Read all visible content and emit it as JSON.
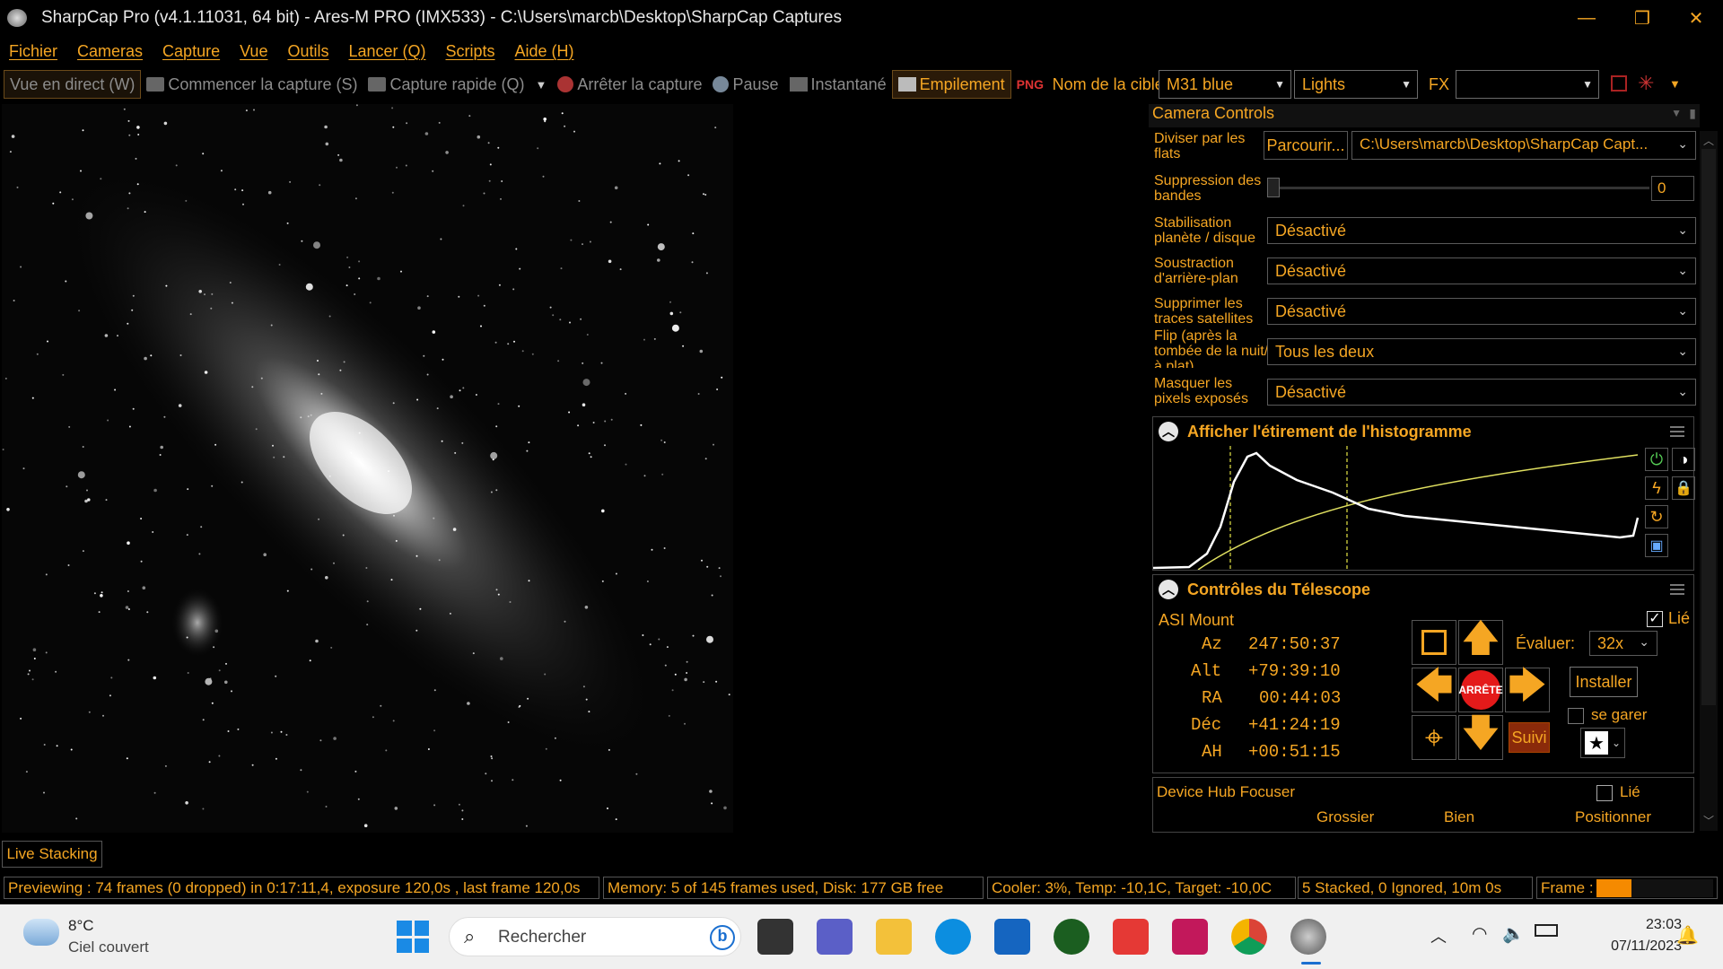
{
  "titlebar": {
    "title": "SharpCap Pro (v4.1.11031, 64 bit) - Ares-M PRO (IMX533) - C:\\Users\\marcb\\Desktop\\SharpCap Captures",
    "minimize": "—",
    "restore": "❐",
    "close": "✕"
  },
  "menu": [
    "Fichier",
    "Cameras",
    "Capture",
    "Vue",
    "Outils",
    "Lancer (Q)",
    "Scripts",
    "Aide (H)"
  ],
  "toolbar": {
    "live_view": "Vue en direct (W)",
    "start_capture": "Commencer la capture (S)",
    "quick_capture": "Capture rapide (Q)",
    "stop_capture": "Arrêter la capture",
    "pause": "Pause",
    "snapshot": "Instantané",
    "stacking": "Empilement",
    "target_label": "Nom de la cible:",
    "target_value": "M31 blue",
    "frame_type": "Lights",
    "fx_label": "FX",
    "fx_value": ""
  },
  "camera_controls": {
    "title": "Camera Controls",
    "flats_label": "Diviser par les flats",
    "browse": "Parcourir...",
    "flats_path": "C:\\Users\\marcb\\Desktop\\SharpCap Capt...",
    "banding_label": "Suppression des bandes",
    "banding_value": "0",
    "stabilization_label": "Stabilisation planète / disque",
    "stabilization_value": "Désactivé",
    "background_label": "Soustraction d'arrière-plan",
    "background_value": "Désactivé",
    "satellite_label": "Supprimer les traces satellites",
    "satellite_value": "Désactivé",
    "flip_label": "Flip (après la tombée de la nuit/à plat)",
    "flip_value": "Tous les deux",
    "mask_label": "Masquer les pixels exposés",
    "mask_value": "Désactivé"
  },
  "histogram": {
    "title": "Afficher l'étirement de l'histogramme"
  },
  "telescope": {
    "title": "Contrôles du Télescope",
    "mount": "ASI Mount",
    "linked": "Lié",
    "az_label": "Az",
    "az": "247:50:37",
    "alt_label": "Alt",
    "alt": "+79:39:10",
    "ra_label": "RA",
    "ra": "00:44:03",
    "dec_label": "Déc",
    "dec": "+41:24:19",
    "ah_label": "AH",
    "ah": "+00:51:15",
    "rate_label": "Évaluer:",
    "rate": "32x",
    "install": "Installer",
    "park": "se garer",
    "stop": "ARRÊTE",
    "track": "Suivi"
  },
  "focuser": {
    "title": "Device Hub Focuser",
    "linked": "Lié",
    "coarse": "Grossier",
    "fine": "Bien",
    "positioner": "Positionner"
  },
  "live_stacking": "Live Stacking",
  "status": {
    "preview": "Previewing : 74 frames (0 dropped) in 0:17:11,4, exposure 120,0s , last frame 120,0s",
    "memory": "Memory: 5 of 145 frames used, Disk: 177 GB free",
    "cooler": "Cooler: 3%, Temp: -10,1C, Target: -10,0C",
    "stacked": "5 Stacked, 0 Ignored, 10m 0s",
    "frame_label": "Frame :",
    "frame_progress": 0.3
  },
  "taskbar": {
    "temp": "8°C",
    "weather": "Ciel couvert",
    "search": "Rechercher",
    "time": "23:03",
    "date": "07/11/2023"
  },
  "colors": {
    "accent": "#f5a623",
    "background": "#000000"
  }
}
